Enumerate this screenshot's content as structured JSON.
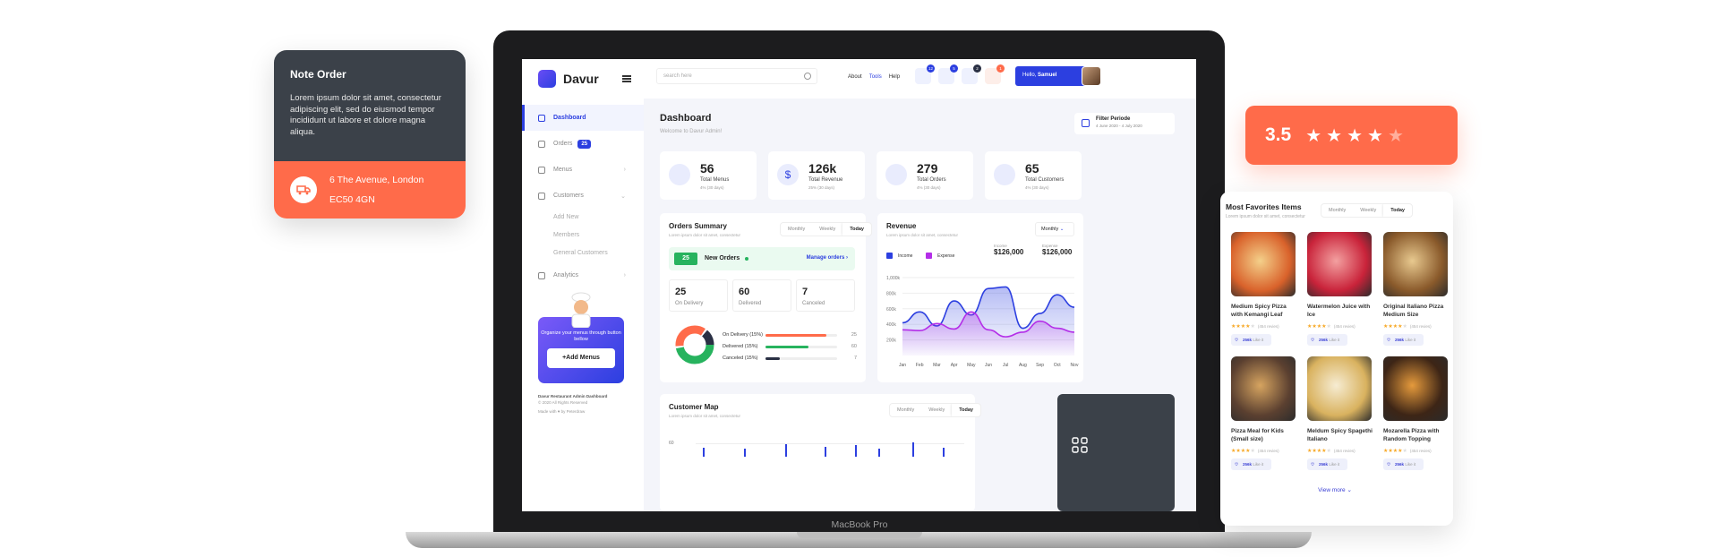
{
  "note_card": {
    "title": "Note Order",
    "body": "Lorem ipsum dolor sit amet, consectetur adipiscing elit, sed do eiusmod tempor incididunt ut labore et dolore magna aliqua.",
    "address_line1": "6 The Avenue, London",
    "address_line2": "EC50 4GN",
    "icon": "truck-icon"
  },
  "rating_card": {
    "value": "3.5",
    "stars_filled": 4,
    "stars_total": 5
  },
  "laptop": {
    "label": "MacBook Pro"
  },
  "app": {
    "brand": "Davur",
    "sidebar": {
      "items": [
        {
          "label": "Dashboard",
          "icon": "home-icon",
          "active": true
        },
        {
          "label": "Orders",
          "icon": "orders-icon",
          "badge": "25"
        },
        {
          "label": "Menus",
          "icon": "menu-icon"
        },
        {
          "label": "Customers",
          "icon": "customers-icon"
        }
      ],
      "sub_items": [
        "Add New",
        "Members",
        "General Customers"
      ],
      "analytics": "Analytics",
      "promo_text": "Organize your menus through button bellow",
      "promo_button": "+Add Menus",
      "footer_title": "Davur Restaurant Admin Dashboard",
      "footer_copy": "© 2020 All Rights Reserved",
      "footer_made": "Made with ♥ by Peterdraw"
    },
    "topbar": {
      "search_placeholder": "search here",
      "links": [
        "About",
        "Tools",
        "Help"
      ],
      "notifications": [
        {
          "icon": "bell-icon",
          "count": "12"
        },
        {
          "icon": "chat-icon",
          "count": "5"
        },
        {
          "icon": "gift-icon",
          "count": "2"
        },
        {
          "icon": "gear-icon",
          "count": "1"
        }
      ],
      "greeting": "Hello,",
      "user": "Samuel"
    },
    "page": {
      "title": "Dashboard",
      "subtitle": "Welcome to Davur Admin!",
      "filter_label": "Filter Periode",
      "filter_range": "4 June 2020 - 4 July 2020"
    },
    "stats": [
      {
        "value": "56",
        "label": "Total Menus",
        "trend": "4% (30 days)",
        "icon": "cup-icon"
      },
      {
        "value": "126k",
        "label": "Total Revenue",
        "trend": "25% (30 days)",
        "icon": "dollar-icon"
      },
      {
        "value": "279",
        "label": "Total Orders",
        "trend": "4% (30 days)",
        "icon": "bag-icon"
      },
      {
        "value": "65",
        "label": "Total Customers",
        "trend": "4% (30 days)",
        "icon": "users-icon"
      }
    ],
    "orders_summary": {
      "title": "Orders Summary",
      "subtitle": "Lorem ipsum dolor sit amet, consectetur",
      "tabs": [
        "Monthly",
        "Weekly",
        "Today"
      ],
      "new_orders_count": "25",
      "new_orders_label": "New Orders",
      "manage_link": "Manage orders",
      "boxes": [
        {
          "value": "25",
          "label": "On Delivery"
        },
        {
          "value": "60",
          "label": "Delivered"
        },
        {
          "value": "7",
          "label": "Canceled"
        }
      ],
      "bars": [
        {
          "label": "On Delivery (15%)",
          "value": 25,
          "pct": 0.85,
          "color": "#ff6b4a"
        },
        {
          "label": "Delivered (15%)",
          "value": 60,
          "pct": 0.6,
          "color": "#27b35e"
        },
        {
          "label": "Canceled (15%)",
          "value": 7,
          "pct": 0.2,
          "color": "#2a3044"
        }
      ]
    },
    "revenue": {
      "title": "Revenue",
      "subtitle": "Lorem ipsum dolor sit amet, consectetur",
      "period": "Monthly",
      "legend": [
        {
          "name": "Income",
          "color": "#2c3fe0"
        },
        {
          "name": "Expense",
          "color": "#b42ee8"
        }
      ],
      "income_label": "Income",
      "income_value": "$126,000",
      "expense_label": "Expense",
      "expense_value": "$126,000"
    },
    "customer_map": {
      "title": "Customer Map",
      "subtitle": "Lorem ipsum dolor sit amet, consectetur",
      "tabs": [
        "Monthly",
        "Weekly",
        "Today"
      ],
      "y_top": "60"
    }
  },
  "chart_data": {
    "type": "area",
    "x": [
      "Jan",
      "Feb",
      "Mar",
      "Apr",
      "May",
      "Jun",
      "Jul",
      "Aug",
      "Sep",
      "Oct",
      "Nov"
    ],
    "ylim": [
      0,
      1000
    ],
    "yticks": [
      "1,000k",
      "800k",
      "600k",
      "400k",
      "200k"
    ],
    "series": [
      {
        "name": "Income",
        "values": [
          420,
          560,
          380,
          700,
          520,
          860,
          880,
          350,
          540,
          780,
          620
        ]
      },
      {
        "name": "Expense",
        "values": [
          330,
          320,
          410,
          340,
          560,
          330,
          240,
          300,
          440,
          350,
          300
        ]
      }
    ]
  },
  "favorites": {
    "title": "Most Favorites Items",
    "subtitle": "Lorem ipsum dolor sit amet, consectetur",
    "tabs": [
      "Monthly",
      "Weekly",
      "Today"
    ],
    "items": [
      {
        "name": "Medium Spicy Pizza with Kemangi Leaf",
        "reviews": "(454 revies)",
        "likes": "256k",
        "color1": "#d9622b",
        "color2": "#f4d08a"
      },
      {
        "name": "Watermelon Juice with Ice",
        "reviews": "(454 revies)",
        "likes": "256k",
        "color1": "#c9233a",
        "color2": "#f3a0a0"
      },
      {
        "name": "Original Italiano Pizza Medium Size",
        "reviews": "(454 revies)",
        "likes": "256k",
        "color1": "#8a5a2b",
        "color2": "#e8c98f"
      },
      {
        "name": "Pizza Meal for Kids (Small size)",
        "reviews": "(454 revies)",
        "likes": "256k",
        "color1": "#5b4030",
        "color2": "#d6a460"
      },
      {
        "name": "Meldum Spicy Spagethi Italiano",
        "reviews": "(454 revies)",
        "likes": "256k",
        "color1": "#d9b25f",
        "color2": "#f6ecd2"
      },
      {
        "name": "Mozarella Pizza with Random Topping",
        "reviews": "(454 revies)",
        "likes": "256k",
        "color1": "#3d2516",
        "color2": "#e59a3c"
      }
    ],
    "like_label": "Like it",
    "view_more": "View more"
  }
}
